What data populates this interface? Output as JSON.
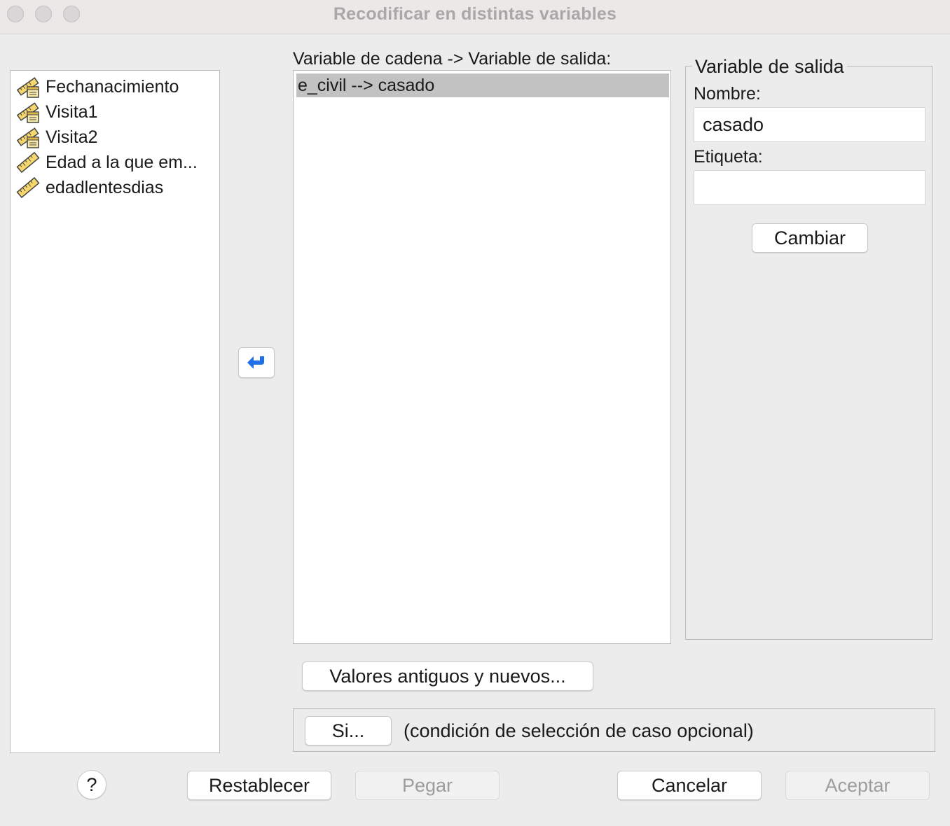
{
  "window": {
    "title": "Recodificar en distintas variables"
  },
  "variables": {
    "items": [
      {
        "label": "Fechanacimiento",
        "icon": "date-ruler-icon"
      },
      {
        "label": "Visita1",
        "icon": "date-ruler-icon"
      },
      {
        "label": "Visita2",
        "icon": "date-ruler-icon"
      },
      {
        "label": "Edad a la que em...",
        "icon": "scale-ruler-icon"
      },
      {
        "label": "edadlentesdias",
        "icon": "scale-ruler-icon"
      }
    ]
  },
  "mapping": {
    "header": "Variable de cadena -> Variable de salida:",
    "rows": [
      "e_civil --> casado"
    ]
  },
  "output": {
    "legend": "Variable de salida",
    "name_label": "Nombre:",
    "name_value": "casado",
    "label_label": "Etiqueta:",
    "label_value": "",
    "change_button": "Cambiar"
  },
  "buttons": {
    "old_new": "Valores antiguos y nuevos...",
    "if": "Si...",
    "if_note": "(condición de selección de caso opcional)",
    "help": "?",
    "reset": "Restablecer",
    "paste": "Pegar",
    "cancel": "Cancelar",
    "ok": "Aceptar"
  },
  "colors": {
    "accent_arrow": "#1f6fe8",
    "selected_row": "#c2c2c2"
  }
}
